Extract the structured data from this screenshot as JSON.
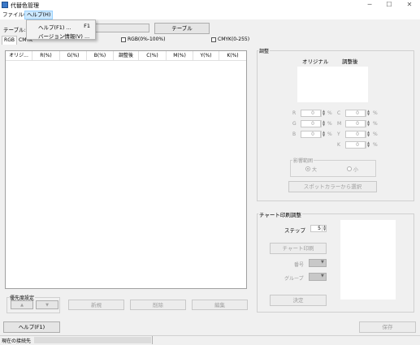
{
  "window": {
    "title": "代替色管理",
    "minimize": "─",
    "maximize": "☐",
    "close": "✕"
  },
  "menu": {
    "file": "ファイル(F)",
    "help": "ヘルプ(H)"
  },
  "help_menu": [
    {
      "label": "ヘルプ(F1) ...",
      "shortcut": "F1"
    },
    {
      "label": "バージョン情報(V) ...",
      "shortcut": ""
    }
  ],
  "table_row": {
    "label": "テーブル:",
    "button": "テーブル"
  },
  "tabs": {
    "rgb": "RGB",
    "cmyk": "CMYK"
  },
  "checkboxes": {
    "rgb_percent": "RGB(0%-100%)",
    "cmyk_255": "CMYK(0-255)"
  },
  "columns": [
    "オリジ...",
    "R(%)",
    "G(%)",
    "B(%)",
    "調整後",
    "C(%)",
    "M(%)",
    "Y(%)",
    "K(%)"
  ],
  "priority": {
    "title": "優先度設定",
    "up": "▲",
    "down": "▼"
  },
  "list_buttons": {
    "new": "新規",
    "delete": "削除",
    "edit": "編集"
  },
  "adjust": {
    "title": "調整",
    "original": "オリジナル",
    "adjusted": "調整後",
    "rgb_fields": [
      {
        "label": "R",
        "value": "0"
      },
      {
        "label": "G",
        "value": "0"
      },
      {
        "label": "B",
        "value": "0"
      }
    ],
    "cmyk_fields": [
      {
        "label": "C",
        "value": "0"
      },
      {
        "label": "M",
        "value": "0"
      },
      {
        "label": "Y",
        "value": "0"
      },
      {
        "label": "K",
        "value": "0"
      }
    ],
    "percent": "%",
    "influence": {
      "title": "影響範囲",
      "large": "大",
      "small": "小"
    },
    "spot_button": "スポットカラーから選択"
  },
  "chart": {
    "title": "チャート印刷調整",
    "step_label": "ステップ",
    "step_value": "5",
    "print_button": "チャート印刷",
    "number_label": "番号",
    "group_label": "グループ",
    "decide_button": "決定"
  },
  "bottom": {
    "help_button": "ヘルプ(F1)",
    "save_button": "保存"
  },
  "status": {
    "label": "現在の接続先"
  }
}
